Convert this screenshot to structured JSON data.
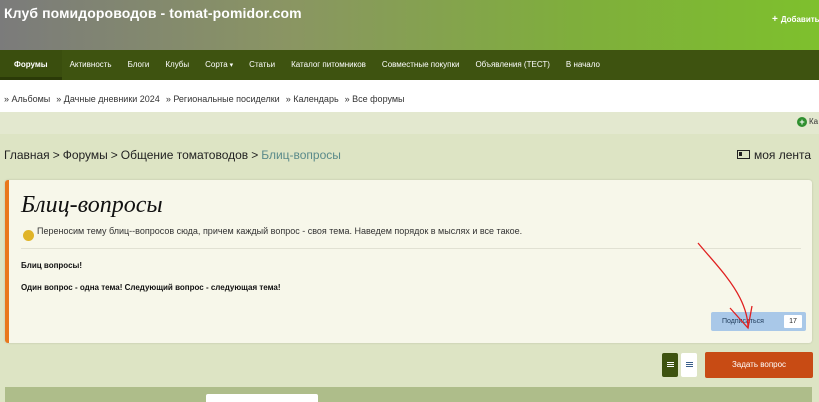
{
  "header": {
    "site_title": "Клуб помидороводов - tomat-pomidor.com",
    "add_label": "Добавить"
  },
  "nav": {
    "items": [
      {
        "label": "Форумы",
        "active": true
      },
      {
        "label": "Активность"
      },
      {
        "label": "Блоги"
      },
      {
        "label": "Клубы"
      },
      {
        "label": "Сорта",
        "dropdown": true
      },
      {
        "label": "Статьи"
      },
      {
        "label": "Каталог питомников"
      },
      {
        "label": "Совместные покупки"
      },
      {
        "label": "Объявления (ТЕСТ)"
      },
      {
        "label": "В начало"
      }
    ]
  },
  "subnav": {
    "items": [
      "» Альбомы",
      "» Дачные дневники 2024",
      "» Региональные посиделки",
      "» Календарь",
      "» Все форумы"
    ]
  },
  "strip": {
    "partial_label": "Ка"
  },
  "breadcrumb": {
    "items": [
      "Главная",
      "Форумы",
      "Общение томатоводов",
      "Блиц-вопросы"
    ],
    "separator": ">"
  },
  "feed_label": "моя лента",
  "forum": {
    "title": "Блиц-вопросы",
    "description": "Переносим тему блиц--вопросов сюда, причем каждый вопрос - своя тема. Наведем порядок в мыслях и все такое.",
    "line1": "Блиц вопросы!",
    "line2": "Один вопрос - одна тема! Следующий вопрос - следующая тема!",
    "follow_label": "Подписаться",
    "follow_count": "17"
  },
  "actions": {
    "new_topic_label": "Задать вопрос"
  },
  "colors": {
    "nav_bg": "#3e5310",
    "accent": "#e9781c",
    "cta": "#c84b14",
    "follow": "#a9c8e8",
    "annotation": "#e02020"
  }
}
